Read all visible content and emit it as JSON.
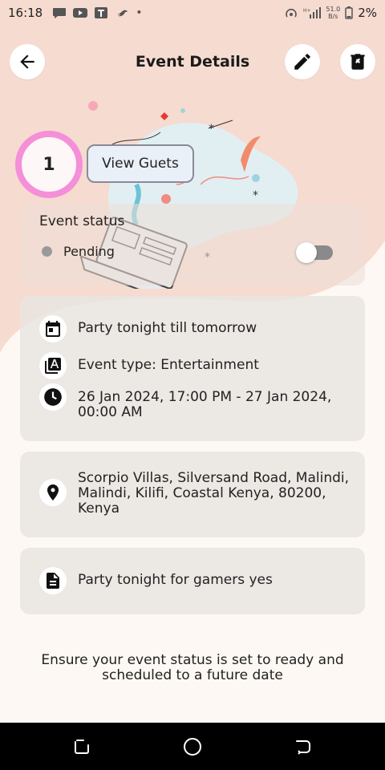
{
  "status_bar": {
    "time": "16:18",
    "net_speed_value": "51.0",
    "net_speed_unit": "B/s",
    "battery": "2%"
  },
  "app_bar": {
    "title": "Event Details",
    "back_icon": "arrow-left-icon",
    "edit_icon": "pencil-icon",
    "delete_icon": "trash-x-icon"
  },
  "guests": {
    "count": "1",
    "button_label": "View Guets"
  },
  "event_status": {
    "label": "Event status",
    "value": "Pending",
    "dot_color": "#9a9a9a",
    "toggle_on": false
  },
  "details": {
    "title": "Party tonight till tomorrow",
    "type": "Event type: Entertainment",
    "datetime": "26 Jan 2024, 17:00 PM - 27 Jan 2024, 00:00 AM"
  },
  "location": {
    "address": "Scorpio Villas, Silversand Road, Malindi, Malindi, Kilifi, Coastal Kenya, 80200, Kenya"
  },
  "description": {
    "text": "Party tonight for gamers yes"
  },
  "footer": {
    "note": "Ensure your event status is set to ready and scheduled to a future date"
  },
  "colors": {
    "accent_ring": "#f48fd8",
    "background": "#fdf8f3",
    "peach": "#f6dbd0"
  }
}
